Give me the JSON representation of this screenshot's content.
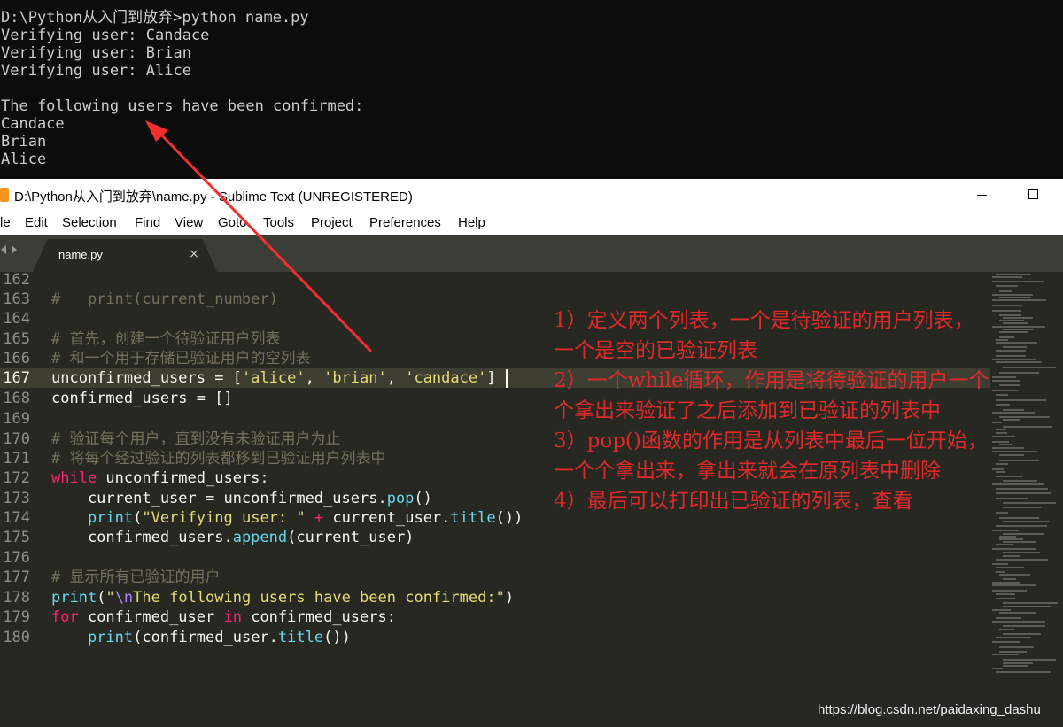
{
  "console": {
    "lines": [
      "D:\\Python从入门到放弃>python name.py",
      "Verifying user: Candace",
      "Verifying user: Brian",
      "Verifying user: Alice",
      "",
      "The following users have been confirmed:",
      "Candace",
      "Brian",
      "Alice"
    ]
  },
  "window": {
    "title": "D:\\Python从入门到放弃\\name.py - Sublime Text (UNREGISTERED)"
  },
  "menu": [
    "le",
    "Edit",
    "Selection",
    "Find",
    "View",
    "Goto",
    "Tools",
    "Project",
    "Preferences",
    "Help"
  ],
  "tab": {
    "label": "name.py",
    "close": "×"
  },
  "editor": {
    "line_numbers": [
      "162",
      "163",
      "164",
      "165",
      "166",
      "167",
      "168",
      "169",
      "170",
      "171",
      "172",
      "173",
      "174",
      "175",
      "176",
      "177",
      "178",
      "179",
      "180"
    ],
    "active_line": "167",
    "code": {
      "l163_c": "#   print(current_number)",
      "l165_c": "# 首先，创建一个待验证用户列表",
      "l166_c": "# 和一个用于存储已验证用户的空列表",
      "l167_a": "unconfirmed_users = [",
      "l167_s1": "'alice'",
      "l167_b": ", ",
      "l167_s2": "'brian'",
      "l167_c": ", ",
      "l167_s3": "'candace'",
      "l167_d": "]",
      "l168": "confirmed_users = []",
      "l170_c": "# 验证每个用户，直到没有未验证用户为止",
      "l171_c": "# 将每个经过验证的列表都移到已验证用户列表中",
      "l172_kw": "while",
      "l172_rest": " unconfirmed_users:",
      "l173_a": "    current_user = unconfirmed_users.",
      "l173_fn": "pop",
      "l173_b": "()",
      "l174_fn": "print",
      "l174_a": "(",
      "l174_s": "\"Verifying user: \"",
      "l174_op": " + ",
      "l174_b": "current_user.",
      "l174_fn2": "title",
      "l174_c": "())",
      "l175_a": "    confirmed_users.",
      "l175_fn": "append",
      "l175_b": "(current_user)",
      "l177_c": "# 显示所有已验证的用户",
      "l178_fn": "print",
      "l178_a": "(",
      "l178_s1": "\"",
      "l178_esc": "\\n",
      "l178_s2": "The following users have been confirmed:\"",
      "l178_b": ")",
      "l179_kw1": "for",
      "l179_a": " confirmed_user ",
      "l179_kw2": "in",
      "l179_b": " confirmed_users:",
      "l180_fn": "print",
      "l180_a": "(confirmed_user.",
      "l180_fn2": "title",
      "l180_b": "())"
    }
  },
  "annotations": [
    "1）定义两个列表，一个是待验证的用户列表，",
    "一个是空的已验证列表",
    "2）一个while循环，作用是将待验证的用户一个",
    "个拿出来验证了之后添加到已验证的列表中",
    "3）pop()函数的作用是从列表中最后一位开始，",
    "一个个拿出来，拿出来就会在原列表中删除",
    "4）最后可以打印出已验证的列表，查看"
  ],
  "watermark": "https://blog.csdn.net/paidaxing_dashu",
  "colors": {
    "console_bg": "#0c0c0c",
    "editor_bg": "#272822",
    "annotation": "#e02a2a",
    "arrow": "#f03030"
  }
}
